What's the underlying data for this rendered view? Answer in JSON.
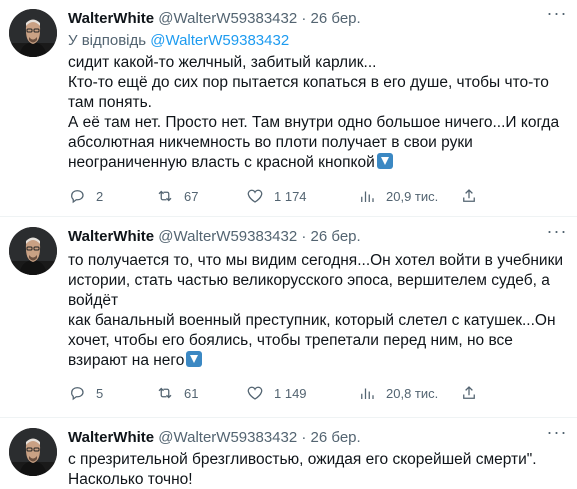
{
  "tweets": [
    {
      "user": {
        "name": "WalterWhite",
        "handle": "@WalterW59383432",
        "sep": "·",
        "date": "26 бер."
      },
      "reply": {
        "prefix": "У відповідь",
        "mention": "@WalterW59383432"
      },
      "lines": [
        "сидит какой-то желчный, забитый карлик...",
        "Кто-то ещё до сих пор пытается копаться в его душе, чтобы что-то там понять.",
        "А её там нет. Просто нет. Там внутри одно большое ничего...И когда абсолютная никчемность во плоти получает в свои руки неограниченную власть с красной кнопкой"
      ],
      "stats": {
        "replies": "2",
        "retweets": "67",
        "likes": "1 174",
        "views": "20,9 тис."
      }
    },
    {
      "user": {
        "name": "WalterWhite",
        "handle": "@WalterW59383432",
        "sep": "·",
        "date": "26 бер."
      },
      "lines": [
        "то получается то, что мы видим сегодня...Он хотел войти в учебники истории, стать частью великорусского эпоса, вершителем судеб, а войдёт",
        "как банальный военный преступник, который слетел с катушек...Он хочет, чтобы его боялись, чтобы трепетали перед ним, но все взирают на него"
      ],
      "stats": {
        "replies": "5",
        "retweets": "61",
        "likes": "1 149",
        "views": "20,8 тис."
      }
    },
    {
      "user": {
        "name": "WalterWhite",
        "handle": "@WalterW59383432",
        "sep": "·",
        "date": "26 бер."
      },
      "lines": [
        "с презрительной брезгливостью, ожидая его скорейшей смерти\".",
        "Насколько точно!"
      ]
    }
  ],
  "icons": {
    "reply": "reply-icon",
    "retweet": "retweet-icon",
    "like": "heart-icon",
    "views": "views-icon",
    "share": "share-icon",
    "emoji": "down-arrow-emoji"
  },
  "colors": {
    "text": "#0f1419",
    "secondary": "#536471",
    "link": "#1d9bf0",
    "divider": "#eff3f4"
  }
}
